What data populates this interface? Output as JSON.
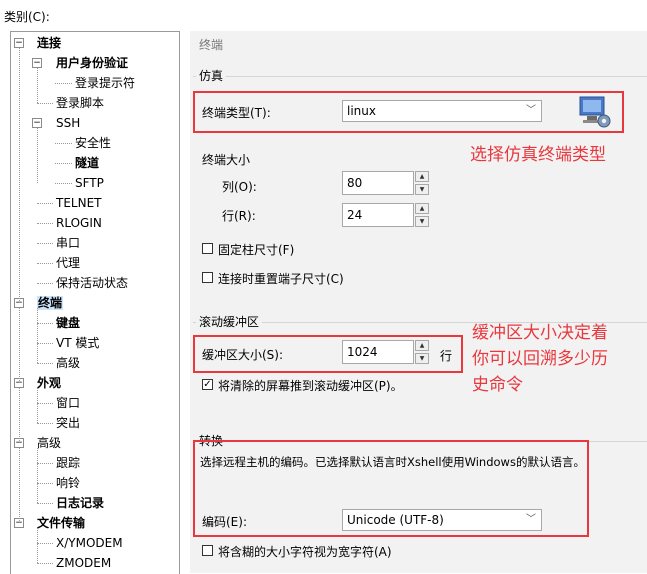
{
  "category_label": "类别(C):",
  "tree": [
    {
      "label": "连接",
      "bold": true,
      "toggle": "−"
    },
    {
      "label": "用户身份验证",
      "bold": true,
      "toggle": "−"
    },
    {
      "label": "登录提示符",
      "bold": false,
      "toggle": ""
    },
    {
      "label": "登录脚本",
      "bold": false,
      "toggle": ""
    },
    {
      "label": "SSH",
      "bold": false,
      "toggle": "−"
    },
    {
      "label": "安全性",
      "bold": false,
      "toggle": ""
    },
    {
      "label": "隧道",
      "bold": true,
      "toggle": ""
    },
    {
      "label": "SFTP",
      "bold": false,
      "toggle": ""
    },
    {
      "label": "TELNET",
      "bold": false,
      "toggle": ""
    },
    {
      "label": "RLOGIN",
      "bold": false,
      "toggle": ""
    },
    {
      "label": "串口",
      "bold": false,
      "toggle": ""
    },
    {
      "label": "代理",
      "bold": false,
      "toggle": ""
    },
    {
      "label": "保持活动状态",
      "bold": false,
      "toggle": ""
    },
    {
      "label": "终端",
      "bold": true,
      "toggle": "−",
      "selected": true
    },
    {
      "label": "键盘",
      "bold": true,
      "toggle": ""
    },
    {
      "label": "VT 模式",
      "bold": false,
      "toggle": ""
    },
    {
      "label": "高级",
      "bold": false,
      "toggle": ""
    },
    {
      "label": "外观",
      "bold": true,
      "toggle": "−"
    },
    {
      "label": "窗口",
      "bold": false,
      "toggle": ""
    },
    {
      "label": "突出",
      "bold": false,
      "toggle": ""
    },
    {
      "label": "高级",
      "bold": false,
      "toggle": "−"
    },
    {
      "label": "跟踪",
      "bold": false,
      "toggle": ""
    },
    {
      "label": "响铃",
      "bold": false,
      "toggle": ""
    },
    {
      "label": "日志记录",
      "bold": true,
      "toggle": ""
    },
    {
      "label": "文件传输",
      "bold": true,
      "toggle": "−"
    },
    {
      "label": "X/YMODEM",
      "bold": false,
      "toggle": ""
    },
    {
      "label": "ZMODEM",
      "bold": false,
      "toggle": ""
    }
  ],
  "header_title": "终端",
  "emulation": {
    "group_title": "仿真",
    "terminal_type_label": "终端类型(T):",
    "terminal_type_value": "linux",
    "size_label": "终端大小",
    "cols_label": "列(O):",
    "cols_value": "80",
    "rows_label": "行(R):",
    "rows_value": "24",
    "fixed_col_label": "固定柱尺寸(F)",
    "reset_on_connect_label": "连接时重置端子尺寸(C)"
  },
  "scroll": {
    "group_title": "滚动缓冲区",
    "buffer_label": "缓冲区大小(S):",
    "buffer_value": "1024",
    "unit": "行",
    "push_cleared_label": "将清除的屏幕推到滚动缓冲区(P)。",
    "push_cleared_checked": true
  },
  "convert": {
    "group_title": "转换",
    "description": "选择远程主机的编码。已选择默认语言时Xshell使用Windows的默认语言。",
    "encoding_label": "编码(E):",
    "encoding_value": "Unicode (UTF-8)",
    "ambiguous_label": "将含糊的大小字符视为宽字符(A)"
  },
  "annotations": {
    "note1": "选择仿真终端类型",
    "note2_lines": [
      "缓冲区大小决定着",
      "你可以回溯多少历",
      "史命令"
    ]
  },
  "colors": {
    "annotation_red": "#e8383d",
    "selected_bg": "#cde3f7",
    "panel_bg": "#f2f2f2"
  },
  "icons": {
    "terminal_settings": "monitor-gear-icon",
    "dropdown": "chevron-down-icon",
    "spin": "spin-arrows-icon"
  }
}
